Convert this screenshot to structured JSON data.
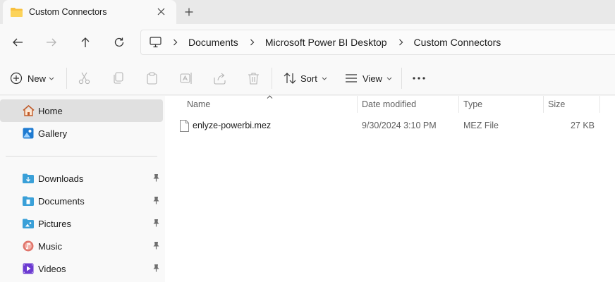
{
  "tab": {
    "title": "Custom Connectors",
    "close_icon": "close-icon",
    "new_tab_icon": "plus-icon"
  },
  "nav": {
    "back_icon": "arrow-left-icon",
    "forward_icon": "arrow-right-icon",
    "up_icon": "arrow-up-icon",
    "refresh_icon": "refresh-icon"
  },
  "breadcrumb": {
    "root_icon": "computer-icon",
    "items": [
      "Documents",
      "Microsoft Power BI Desktop",
      "Custom Connectors"
    ]
  },
  "toolbar": {
    "new_label": "New",
    "sort_label": "Sort",
    "view_label": "View",
    "icons": [
      "cut-icon",
      "copy-icon",
      "paste-icon",
      "rename-icon",
      "share-icon",
      "delete-icon",
      "more-icon"
    ]
  },
  "sidebar": {
    "items": [
      {
        "label": "Home",
        "icon": "home-icon",
        "active": true
      },
      {
        "label": "Gallery",
        "icon": "gallery-icon",
        "active": false
      }
    ],
    "quick_access": [
      {
        "label": "Downloads",
        "icon": "downloads-folder-icon",
        "pinned": true
      },
      {
        "label": "Documents",
        "icon": "documents-folder-icon",
        "pinned": true
      },
      {
        "label": "Pictures",
        "icon": "pictures-folder-icon",
        "pinned": true
      },
      {
        "label": "Music",
        "icon": "music-folder-icon",
        "pinned": true
      },
      {
        "label": "Videos",
        "icon": "videos-folder-icon",
        "pinned": true
      }
    ]
  },
  "files": {
    "columns": [
      "Name",
      "Date modified",
      "Type",
      "Size"
    ],
    "rows": [
      {
        "name": "enlyze-powerbi.mez",
        "date": "9/30/2024 3:10 PM",
        "type": "MEZ File",
        "size": "27 KB"
      }
    ]
  }
}
